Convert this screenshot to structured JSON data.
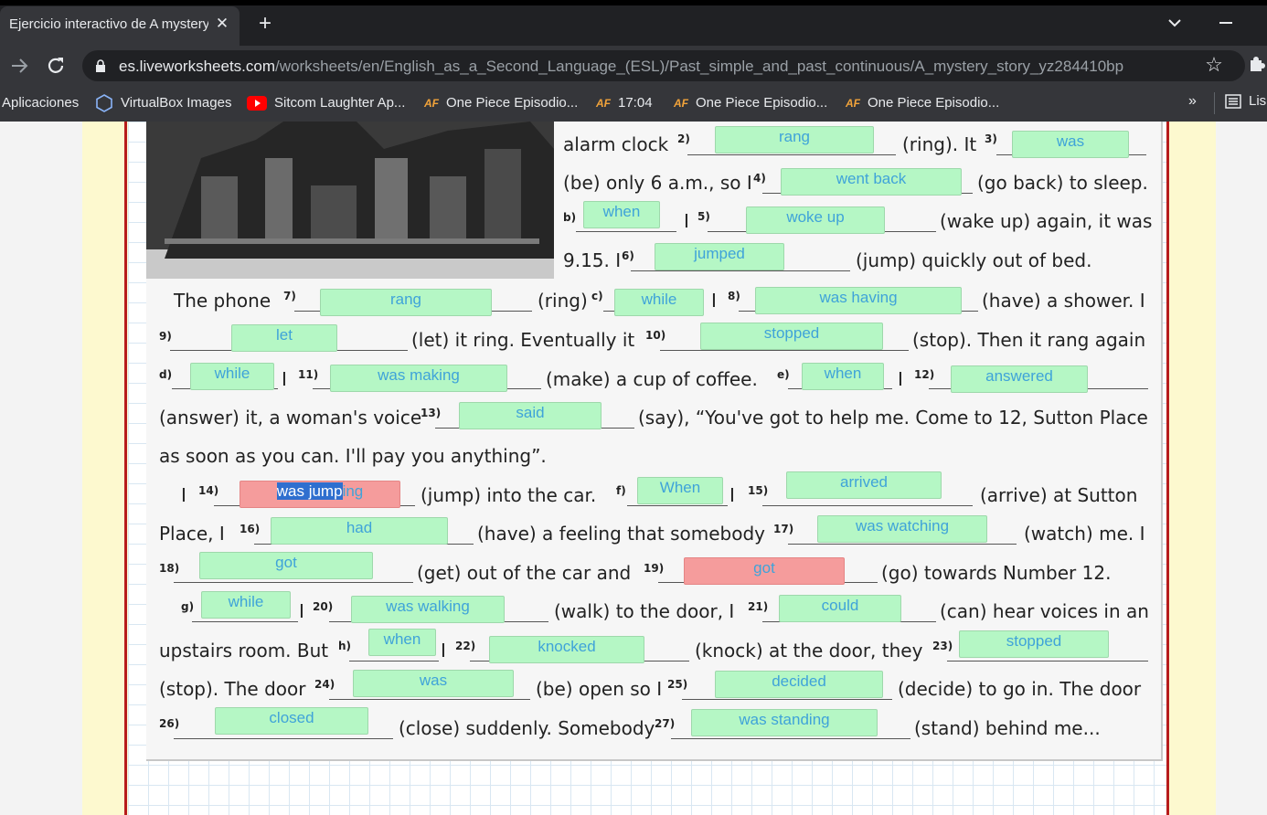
{
  "browser": {
    "tab_title": "Ejercicio interactivo de A mystery",
    "tab_close": "✕",
    "new_tab": "+",
    "url_host": "es.liveworksheets.com",
    "url_path": "/worksheets/en/English_as_a_Second_Language_(ESL)/Past_simple_and_past_continuous/A_mystery_story_yz284410bp",
    "bookmarks": [
      "Aplicaciones",
      "VirtualBox Images",
      "Sitcom Laughter Ap...",
      "One Piece Episodio...",
      "17:04",
      "One Piece Episodio...",
      "One Piece Episodio..."
    ],
    "bookmarks_more": "»",
    "reading_list": "Lis",
    "af_logo": "AF"
  },
  "worksheet": {
    "rows": [
      {
        "t1": "alarm clock ",
        "n1": "2)",
        "t2": "(ring). It ",
        "n2": "3)"
      },
      {
        "t1": "(be) only 6 a.m., so I ",
        "n1": "4)",
        "t2": "(go back) to sleep."
      },
      {
        "n0": "b)",
        "t1": "I ",
        "n1": "5)",
        "t2": "(wake up) again, it was"
      },
      {
        "t1": "9.15. I ",
        "n1": "6)",
        "t2": "(jump) quickly out of bed."
      },
      {
        "t1": "The phone ",
        "n1": "7)",
        "t2": "(ring) ",
        "n2": "c)",
        "t3": "I ",
        "n3": "8)",
        "t4": "(have) a shower. I"
      },
      {
        "n0": "9)",
        "t1": "(let) it ring. Eventually it ",
        "n1": "10)",
        "t2": "(stop). Then it rang again"
      },
      {
        "n0": "d)",
        "t1": "I ",
        "n1": "11)",
        "t2": "(make) a cup of coffee. ",
        "n2": "e)",
        "t3": "I ",
        "n3": "12)"
      },
      {
        "t1": "(answer) it, a woman's voice ",
        "n1": "13)",
        "t2": "(say), “You've got to help me. Come to 12, Sutton Place"
      },
      {
        "t1": "as soon as you can. I'll pay you anything”."
      },
      {
        "t0": "I ",
        "n0": "14)",
        "t1": "(jump) into the car. ",
        "n1": "f)",
        "t2": "I ",
        "n2": "15)",
        "t3": "(arrive) at Sutton"
      },
      {
        "t1": "Place, I ",
        "n1": "16)",
        "t2": "(have) a feeling that somebody ",
        "n2": "17)",
        "t3": "(watch) me. I"
      },
      {
        "n0": "18)",
        "t1": "(get) out of the car and ",
        "n1": "19)",
        "t2": "(go) towards Number 12."
      },
      {
        "n0": "g)",
        "t1": "I ",
        "n1": "20)",
        "t2": "(walk) to the door, I ",
        "n2": "21)",
        "t3": "(can) hear voices in an"
      },
      {
        "t1": "upstairs room. But ",
        "n1": "h)",
        "t2": "I ",
        "n2": "22)",
        "t3": "(knock) at the door, they ",
        "n3": "23)"
      },
      {
        "t1": "(stop). The door ",
        "n1": "24)",
        "t2": "(be) open so I ",
        "n2": "25)",
        "t3": "(decide) to go in. The door"
      },
      {
        "n0": "26)",
        "t1": "(close) suddenly. Somebody ",
        "n1": "27)",
        "t2": "(stand) behind me..."
      }
    ],
    "answers": {
      "a2": "rang",
      "a3": "was",
      "a4": "went back",
      "ab": "when",
      "a5": "woke up",
      "a6": "jumped",
      "a7": "rang",
      "ac": "while",
      "a8": "was having",
      "a9": "let",
      "a10": "stopped",
      "ad": "while",
      "a11": "was making",
      "ae": "when",
      "a12": "answered",
      "a13": "said",
      "a14_selected": "was jump",
      "a14_rest": "ing",
      "af": "When",
      "a15": "arrived",
      "a16": "had",
      "a17": "was watching",
      "a18": "got",
      "a19": "got",
      "ag": "while",
      "a20": "was walking",
      "a21": "could",
      "ah": "when",
      "a22": "knocked",
      "a23": "stopped",
      "a24": "was",
      "a25": "decided",
      "a26": "closed",
      "a27": "was standing"
    }
  }
}
